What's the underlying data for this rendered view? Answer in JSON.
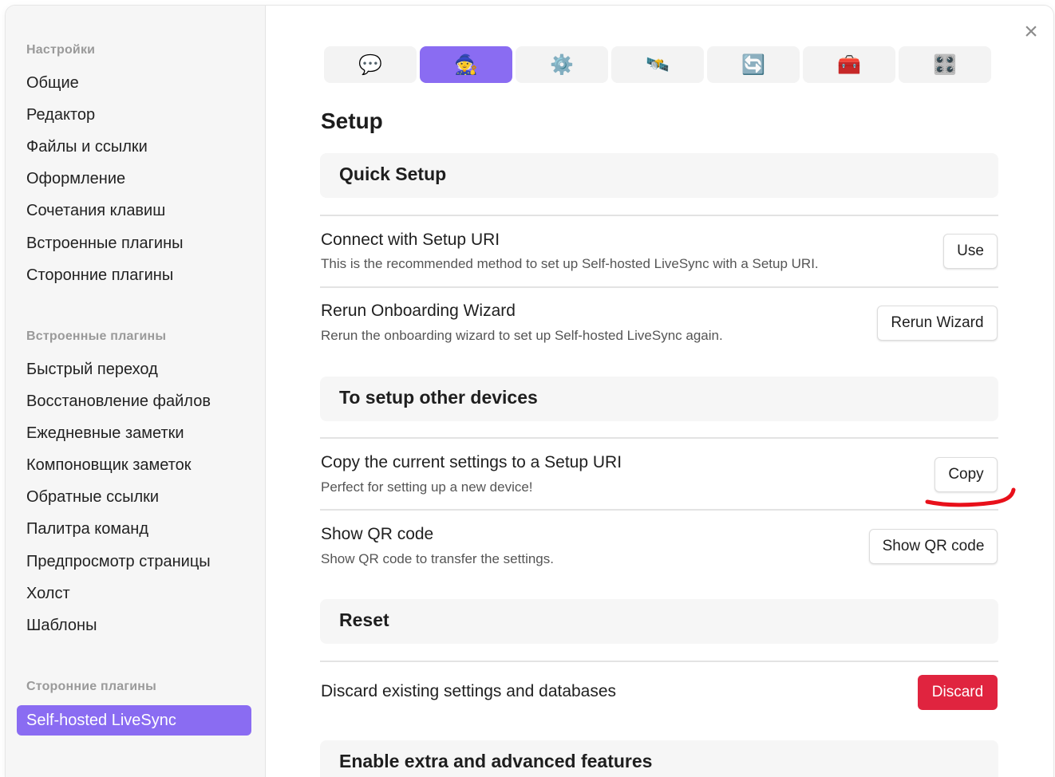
{
  "window": {
    "close_glyph": "×"
  },
  "sidebar": {
    "sections": [
      {
        "header": "Настройки",
        "items": [
          "Общие",
          "Редактор",
          "Файлы и ссылки",
          "Оформление",
          "Сочетания клавиш",
          "Встроенные плагины",
          "Сторонние плагины"
        ]
      },
      {
        "header": "Встроенные плагины",
        "items": [
          "Быстрый переход",
          "Восстановление файлов",
          "Ежедневные заметки",
          "Компоновщик заметок",
          "Обратные ссылки",
          "Палитра команд",
          "Предпросмотр страницы",
          "Холст",
          "Шаблоны"
        ]
      },
      {
        "header": "Сторонние плагины",
        "active_item": "Self-hosted LiveSync"
      }
    ]
  },
  "tabs": [
    {
      "icon": "speech-bubble-icon",
      "glyph": "💬",
      "active": false
    },
    {
      "icon": "wizard-icon",
      "glyph": "🧙",
      "active": true
    },
    {
      "icon": "gear-icon",
      "glyph": "⚙️",
      "active": false
    },
    {
      "icon": "satellite-icon",
      "glyph": "🛰️",
      "active": false
    },
    {
      "icon": "sync-icon",
      "glyph": "🔄",
      "active": false
    },
    {
      "icon": "toolbox-icon",
      "glyph": "🧰",
      "active": false
    },
    {
      "icon": "grid-icon",
      "glyph": "🎛️",
      "active": false
    }
  ],
  "main": {
    "title": "Setup",
    "sections": {
      "quick_setup": "Quick Setup",
      "other_devices": "To setup other devices",
      "reset": "Reset",
      "advanced": "Enable extra and advanced features"
    },
    "rows": {
      "connect": {
        "title": "Connect with Setup URI",
        "desc": "This is the recommended method to set up Self-hosted LiveSync with a Setup URI.",
        "button": "Use"
      },
      "rerun": {
        "title": "Rerun Onboarding Wizard",
        "desc": "Rerun the onboarding wizard to set up Self-hosted LiveSync again.",
        "button": "Rerun Wizard"
      },
      "copy": {
        "title": "Copy the current settings to a Setup URI",
        "desc": "Perfect for setting up a new device!",
        "button": "Copy"
      },
      "qr": {
        "title": "Show QR code",
        "desc": "Show QR code to transfer the settings.",
        "button": "Show QR code"
      },
      "discard": {
        "title": "Discard existing settings and databases",
        "button": "Discard"
      }
    }
  },
  "colors": {
    "accent": "#8a6cf2",
    "danger": "#e0243f",
    "annotation": "#e8101a"
  }
}
